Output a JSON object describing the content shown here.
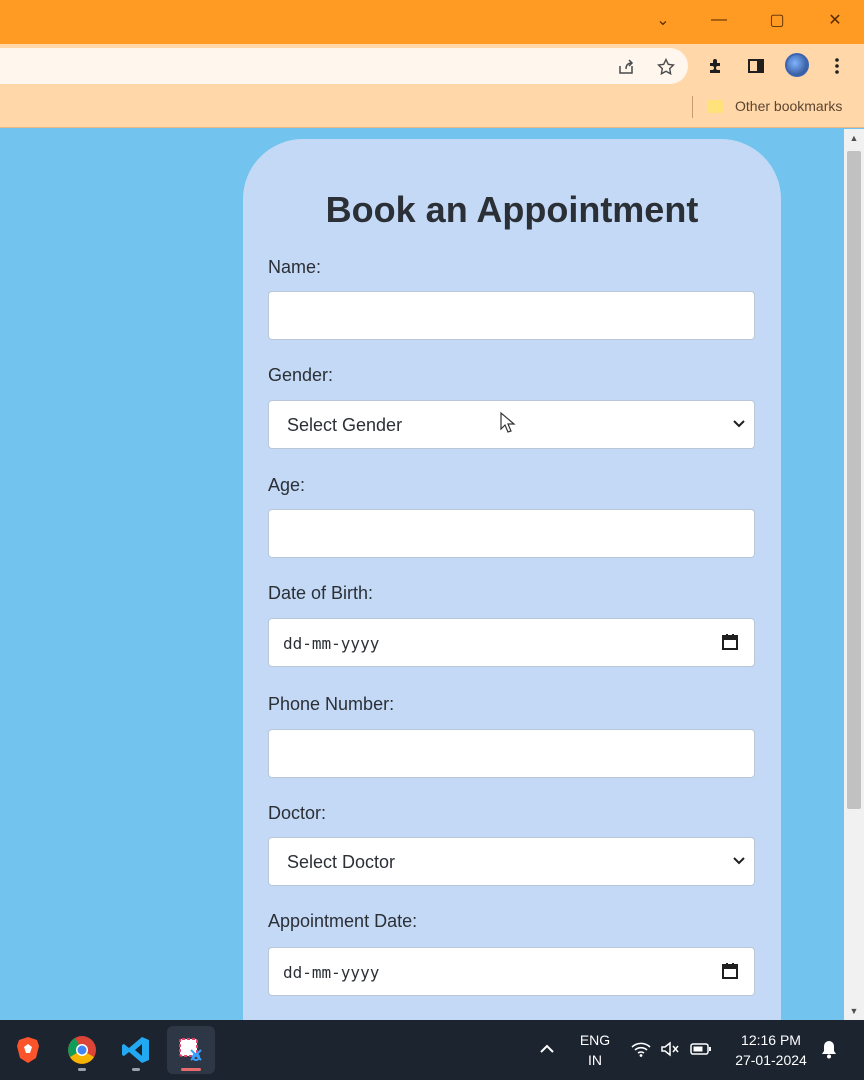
{
  "browser": {
    "window_controls": {
      "dropdown": "⌄",
      "minimize": "—",
      "restore": "▢",
      "close": "✕"
    },
    "bookmarks_bar": {
      "other_bookmarks": "Other bookmarks"
    }
  },
  "form": {
    "title": "Book an Appointment",
    "fields": [
      {
        "label": "Name:",
        "value": ""
      },
      {
        "label": "Gender:",
        "selected": "Select Gender"
      },
      {
        "label": "Age:",
        "value": ""
      },
      {
        "label": "Date of Birth:",
        "placeholder": "dd-mm-yyyy"
      },
      {
        "label": "Phone Number:",
        "value": ""
      },
      {
        "label": "Doctor:",
        "selected": "Select Doctor"
      },
      {
        "label": "Appointment Date:",
        "placeholder": "dd-mm-yyyy"
      }
    ]
  },
  "taskbar": {
    "language": {
      "line1": "ENG",
      "line2": "IN"
    },
    "time": "12:16 PM",
    "date": "27-01-2024"
  },
  "colors": {
    "titlebar": "#ff9a23",
    "toolbar": "#ffd7a8",
    "page_background": "#72c4ee",
    "card": "#c4d9f5",
    "taskbar": "#1c2430"
  }
}
